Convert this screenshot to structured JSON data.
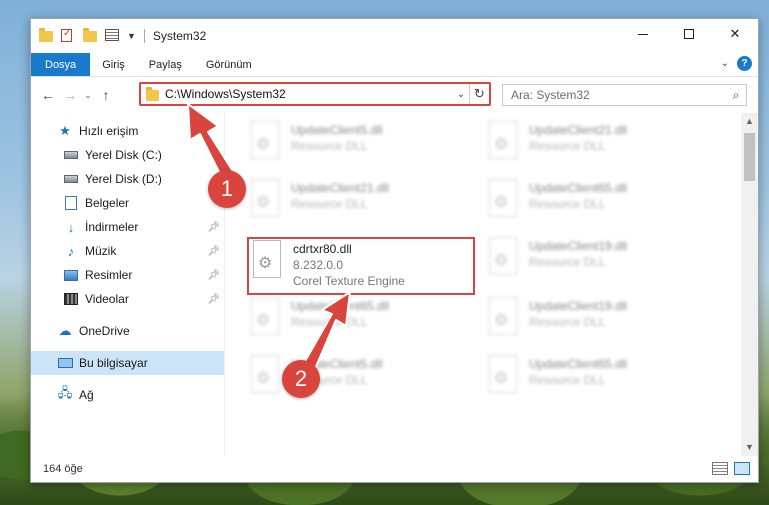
{
  "window": {
    "title": "System32"
  },
  "ribbon": {
    "tabs": [
      "Dosya",
      "Giriş",
      "Paylaş",
      "Görünüm"
    ]
  },
  "address": {
    "path": "C:\\Windows\\System32"
  },
  "search": {
    "placeholder": "Ara: System32"
  },
  "navpane": {
    "items": [
      {
        "label": "Hızlı erişim",
        "icon": "star-icon"
      },
      {
        "label": "Yerel Disk (C:)",
        "icon": "disk-icon"
      },
      {
        "label": "Yerel Disk (D:)",
        "icon": "disk-icon"
      },
      {
        "label": "Belgeler",
        "icon": "document-icon"
      },
      {
        "label": "İndirmeler",
        "icon": "download-icon"
      },
      {
        "label": "Müzik",
        "icon": "music-icon"
      },
      {
        "label": "Resimler",
        "icon": "pictures-icon"
      },
      {
        "label": "Videolar",
        "icon": "video-icon"
      },
      {
        "label": "OneDrive",
        "icon": "cloud-icon"
      },
      {
        "label": "Bu bilgisayar",
        "icon": "computer-icon"
      },
      {
        "label": "Ağ",
        "icon": "network-icon"
      }
    ]
  },
  "files": [
    {
      "name": "UpdateClient5.dll",
      "desc": "Resource DLL",
      "blurred": true
    },
    {
      "name": "UpdateClient21.dll",
      "desc": "Resource DLL",
      "blurred": true
    },
    {
      "name": "UpdateClient21.dll",
      "desc": "Resource DLL",
      "blurred": true
    },
    {
      "name": "UpdateClient65.dll",
      "desc": "Resource DLL",
      "blurred": true
    },
    {
      "name": "cdrtxr80.dll",
      "version": "8.232.0.0",
      "desc": "Corel Texture Engine",
      "blurred": false
    },
    {
      "name": "UpdateClient19.dll",
      "desc": "Resource DLL",
      "blurred": true
    },
    {
      "name": "UpdateClient65.dll",
      "desc": "Resource DLL",
      "blurred": true
    },
    {
      "name": "UpdateClient19.dll",
      "desc": "Resource DLL",
      "blurred": true
    },
    {
      "name": "UpdateClient5.dll",
      "desc": "Resource DLL",
      "blurred": true
    },
    {
      "name": "UpdateClient65.dll",
      "desc": "Resource DLL",
      "blurred": true
    }
  ],
  "status": {
    "count": "164 öğe"
  },
  "annotations": {
    "step1": "1",
    "step2": "2",
    "color": "#d9443c"
  }
}
